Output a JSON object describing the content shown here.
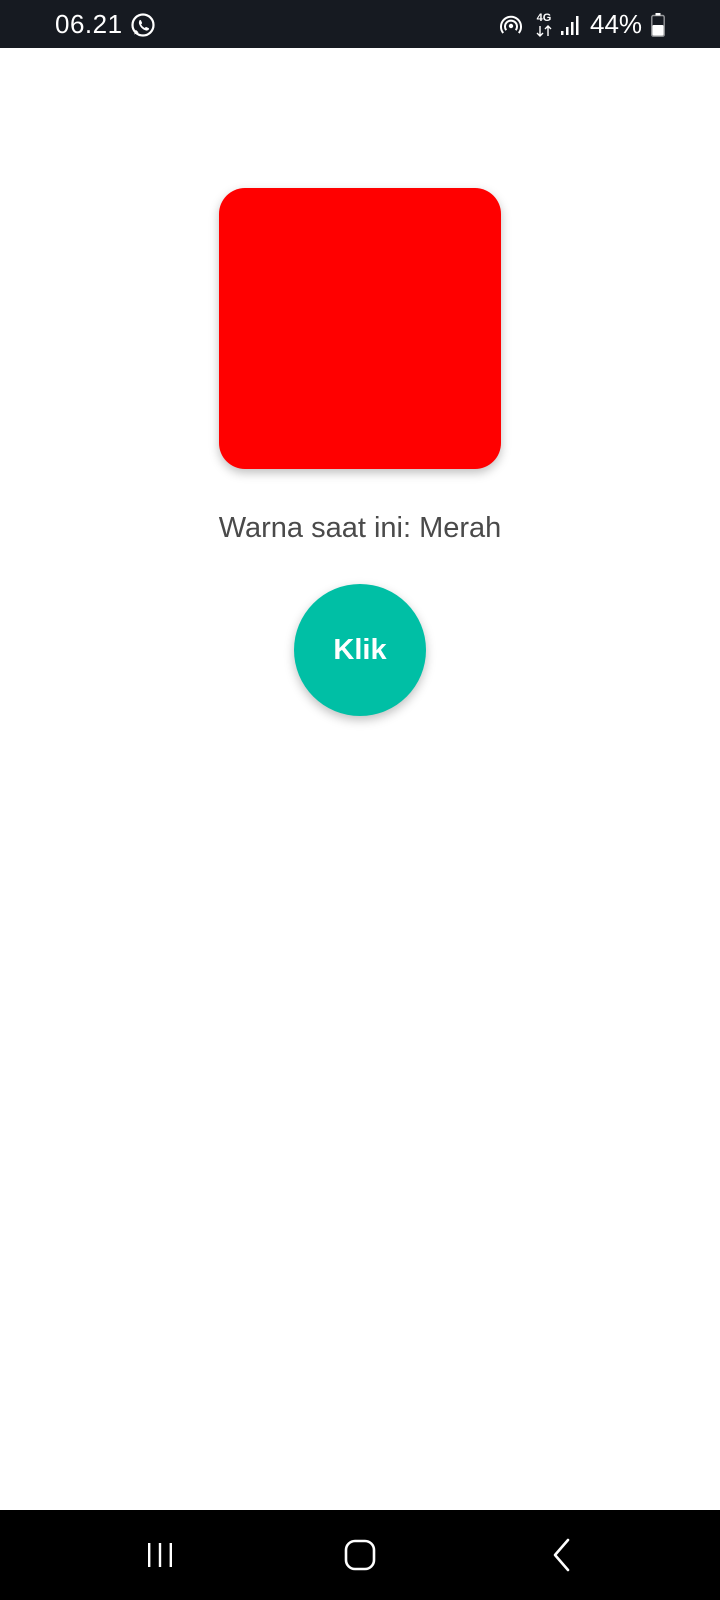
{
  "status_bar": {
    "time": "06.21",
    "network_type": "4G",
    "battery_percent": "44%",
    "icons": [
      "whatsapp-icon",
      "hotspot-icon",
      "signal-icon",
      "battery-icon"
    ]
  },
  "main": {
    "color_box": {
      "color": "#ff0000"
    },
    "color_label": "Warna saat ini: Merah",
    "button": {
      "label": "Klik",
      "color": "#00bfa5"
    }
  },
  "nav_bar": {
    "buttons": [
      "recents-button",
      "home-button",
      "back-button"
    ]
  }
}
